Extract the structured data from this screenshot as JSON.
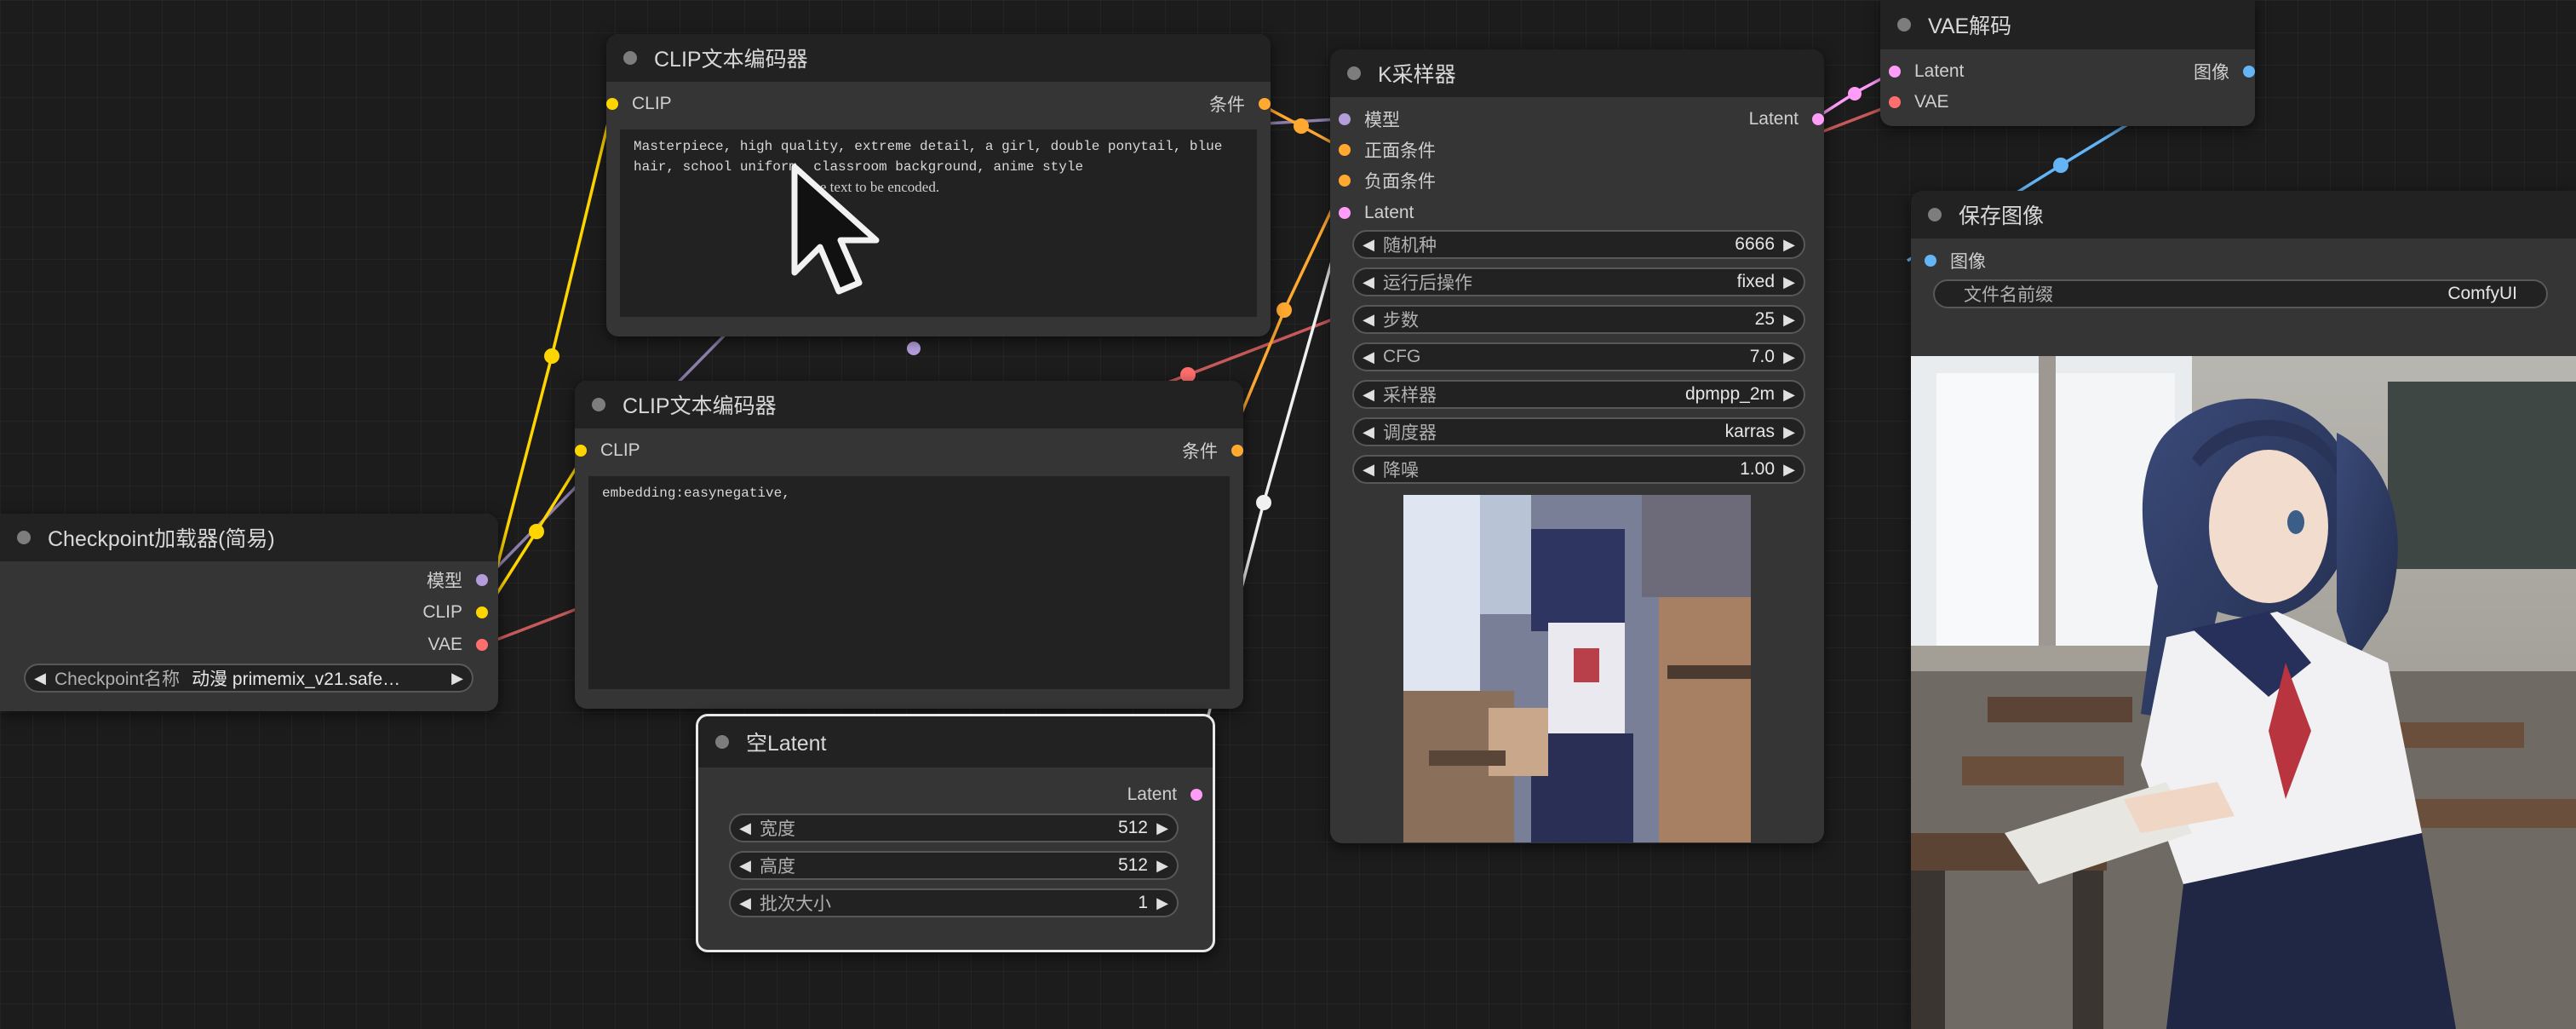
{
  "colors": {
    "model": "#b39ddb",
    "clip": "#ffd500",
    "vae": "#ff6e6e",
    "conditioning": "#ffa931",
    "latent": "#ff9cf9",
    "image": "#64b5f6"
  },
  "clip_encoder_1": {
    "title": "CLIP文本编码器",
    "input_clip": "CLIP",
    "output_cond": "条件",
    "text": "Masterpiece, high quality, extreme detail, a girl, double ponytail, blue hair, school uniform, classroom background, anime style",
    "placeholder": "The text to be encoded."
  },
  "clip_encoder_2": {
    "title": "CLIP文本编码器",
    "input_clip": "CLIP",
    "output_cond": "条件",
    "text": "embedding:easynegative,"
  },
  "checkpoint_loader": {
    "title": "Checkpoint加载器(简易)",
    "output_model": "模型",
    "output_clip": "CLIP",
    "output_vae": "VAE",
    "widget_label": "Checkpoint名称",
    "widget_value": "动漫 primemix_v21.safe…"
  },
  "empty_latent": {
    "title": "空Latent",
    "output_latent": "Latent",
    "widgets": [
      {
        "label": "宽度",
        "value": "512"
      },
      {
        "label": "高度",
        "value": "512"
      },
      {
        "label": "批次大小",
        "value": "1"
      }
    ]
  },
  "ksampler": {
    "title": "K采样器",
    "input_model": "模型",
    "input_positive": "正面条件",
    "input_negative": "负面条件",
    "input_latent": "Latent",
    "output_latent": "Latent",
    "widgets": [
      {
        "label": "随机种",
        "value": "6666"
      },
      {
        "label": "运行后操作",
        "value": "fixed"
      },
      {
        "label": "步数",
        "value": "25"
      },
      {
        "label": "CFG",
        "value": "7.0"
      },
      {
        "label": "采样器",
        "value": "dpmpp_2m"
      },
      {
        "label": "调度器",
        "value": "karras"
      },
      {
        "label": "降噪",
        "value": "1.00"
      }
    ]
  },
  "vae_decode": {
    "title": "VAE解码",
    "input_latent": "Latent",
    "input_vae": "VAE",
    "output_image": "图像"
  },
  "save_image": {
    "title": "保存图像",
    "input_image": "图像",
    "widget_label": "文件名前缀",
    "widget_value": "ComfyUI"
  }
}
